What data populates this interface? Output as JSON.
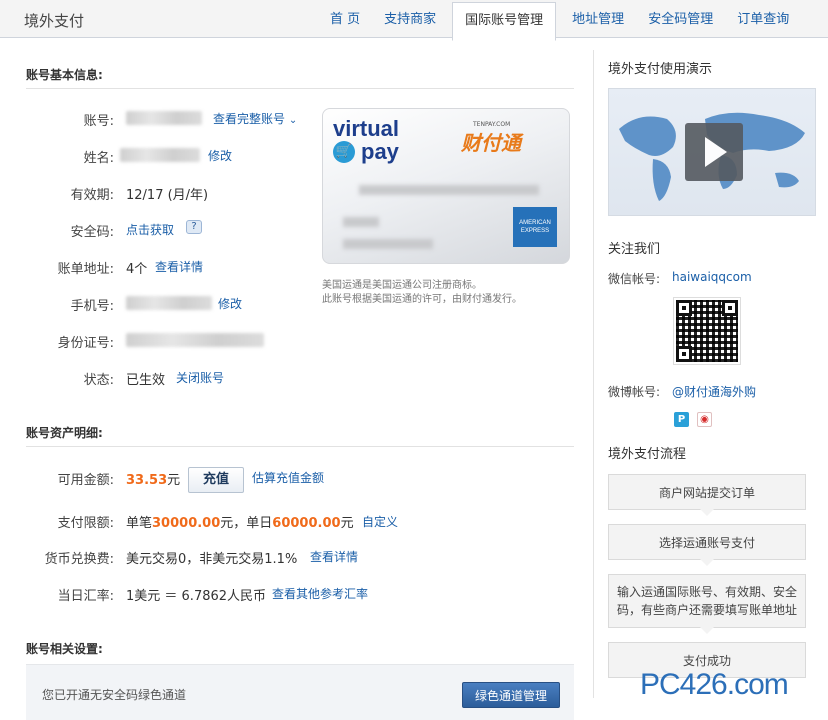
{
  "header": {
    "brand": "境外支付",
    "nav": [
      "首 页",
      "支持商家",
      "国际账号管理",
      "地址管理",
      "安全码管理",
      "订单查询"
    ],
    "active_index": 2
  },
  "basic": {
    "title": "账号基本信息:",
    "account_label": "账号:",
    "view_full_link": "查看完整账号",
    "name_label": "姓名:",
    "name_edit": "修改",
    "expiry_label": "有效期:",
    "expiry_value": "12/17 (月/年)",
    "code_label": "安全码:",
    "code_link": "点击获取",
    "address_label": "账单地址:",
    "address_count": "4个",
    "address_link": "查看详情",
    "phone_label": "手机号:",
    "phone_edit": "修改",
    "id_label": "身份证号:",
    "status_label": "状态:",
    "status_value": "已生效",
    "close_link": "关闭账号"
  },
  "card": {
    "virtual": "virtual",
    "pay": "pay",
    "tenpay_small": "TENPAY.COM",
    "tenpay": "财付通",
    "amex": "AMERICAN EXPRESS",
    "note1": "美国运通是美国运通公司注册商标。",
    "note2": "此账号根据美国运通的许可，由财付通发行。"
  },
  "assets": {
    "title": "账号资产明细:",
    "balance_label": "可用金额:",
    "balance_value": "33.53",
    "balance_unit": "元",
    "recharge_button": "充值",
    "estimate_link": "估算充值金额",
    "limit_label": "支付限额:",
    "limit_single_prefix": "单笔",
    "limit_single": "30000.00",
    "limit_single_suffix": "元，单日",
    "limit_daily": "60000.00",
    "limit_daily_suffix": "元",
    "custom_link": "自定义",
    "fee_label": "货币兑换费:",
    "fee_value": "美元交易0，非美元交易1.1%",
    "fee_link": "查看详情",
    "rate_label": "当日汇率:",
    "rate_value": "1美元 ＝ 6.7862人民币",
    "rate_link": "查看其他参考汇率"
  },
  "settings": {
    "title": "账号相关设置:",
    "green_text": "您已开通无安全码绿色通道",
    "green_button": "绿色通道管理"
  },
  "sidebar": {
    "demo_title": "境外支付使用演示",
    "follow_title": "关注我们",
    "wechat_label": "微信帐号:",
    "wechat_value": "haiwaiqqcom",
    "weibo_label": "微博帐号:",
    "weibo_value": "@财付通海外购",
    "flow_title": "境外支付流程",
    "steps": [
      "商户网站提交订单",
      "选择运通账号支付",
      "输入运通国际账号、有效期、安全码，有些商户还需要填写账单地址",
      "支付成功"
    ]
  },
  "watermark": "PC426.com"
}
